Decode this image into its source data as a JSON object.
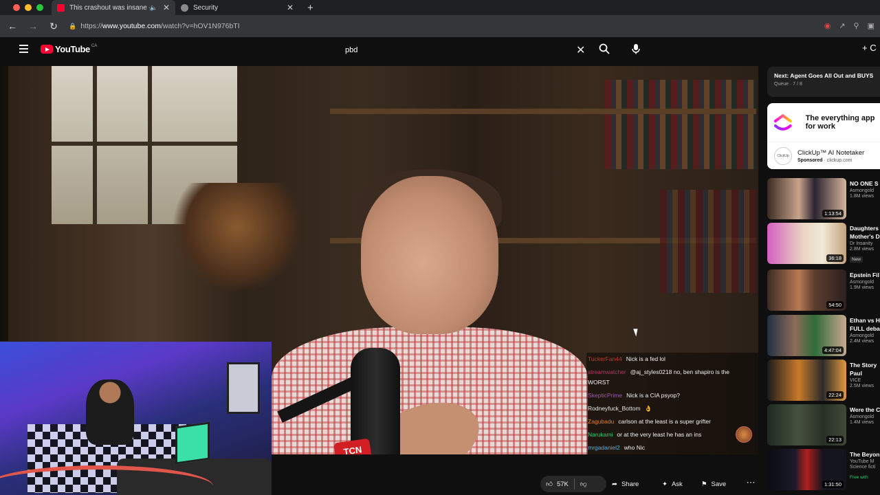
{
  "browser": {
    "tabs": [
      {
        "title": "This crashout was insane -",
        "favicon_color": "#ff0033",
        "active": true
      },
      {
        "title": "Security",
        "favicon_color": "#8a8a8a",
        "active": false
      }
    ],
    "url_scheme": "https://",
    "url_host": "www.youtube.com",
    "url_path": "/watch?v=hOV1N976bTI"
  },
  "youtube": {
    "logo_text": "YouTube",
    "country_code": "CA",
    "search_query": "pbd",
    "create_icon": "plus-icon"
  },
  "chat": [
    {
      "user": "TuckerFan44",
      "msg": "Nick is a fed lol",
      "color": "#c0392b"
    },
    {
      "user": "streamwatcher",
      "msg": "@aj_styles0218 no, ben shapiro is the",
      "color": "#b03a6b"
    },
    {
      "user": "",
      "msg": "WORST",
      "color": "#ffffff"
    },
    {
      "user": "SkepticPrime",
      "msg": "Nick is a CIA psyop?",
      "color": "#9b59b6"
    },
    {
      "user": "Rodneyfuck_Bottom",
      "msg": "",
      "color": "#e8e8e8"
    },
    {
      "user": "Zagubadu",
      "msg": "carlson at the least is a super grifter",
      "color": "#e67e22"
    },
    {
      "user": "Narukami",
      "msg": "or at the very least he has an ins",
      "color": "#2ecc71"
    },
    {
      "user": "mrgadaniel2",
      "msg": "who Nic",
      "color": "#5dade2"
    }
  ],
  "actions": {
    "likes": "57K",
    "share": "Share",
    "ask": "Ask",
    "save": "Save"
  },
  "sidebar": {
    "next": {
      "title": "Next: Agent Goes All Out and BUYS",
      "queue": "Queue · 7 / 8"
    },
    "ad": {
      "headline": "The everything app for work",
      "name": "ClickUp™ AI Notetaker",
      "sponsored": "Sponsored",
      "domain": "clickup.com",
      "avatar_text": "ClickUp"
    },
    "recs": [
      {
        "title": "NO ONE S",
        "channel": "Asmongold",
        "views": "1.8M views",
        "duration": "1:13:54",
        "badge": "",
        "thumb": "linear-gradient(90deg,#3b2b22,#c9a48c 40%,#2a2430 60%,#d4b59c)"
      },
      {
        "title": "Daughters",
        "title2": "Mother's D",
        "channel": "Dr Insanity",
        "views": "2.8M views",
        "duration": "36:18",
        "badge": "New",
        "thumb": "linear-gradient(90deg,#d35fbf,#e9d5c2 45%,#f1e8d8 70%,#c3a27a)"
      },
      {
        "title": "Epstein Fil",
        "channel": "Asmongold",
        "views": "1.9M views",
        "duration": "54:50",
        "badge": "",
        "thumb": "linear-gradient(90deg,#3a2a23,#b77a55 40%,#5b3d2d 60%,#2d2020)"
      },
      {
        "title": "Ethan vs H",
        "title2": "FULL deba",
        "channel": "Asmongold",
        "views": "2.4M views",
        "duration": "4:47:04",
        "badge": "",
        "thumb": "linear-gradient(90deg,#1f3140,#8d6c5a 35%,#2e6b3a 60%,#c7a98e)"
      },
      {
        "title": "The Story",
        "title2": "Paul",
        "channel": "VICE",
        "views": "2.5M views",
        "duration": "22:24",
        "badge": "",
        "thumb": "linear-gradient(90deg,#1b1b1b,#c97a2a 40%,#2b2b2b 70%,#e39a3c)"
      },
      {
        "title": "Were the C",
        "channel": "Asmongold",
        "views": "1.4M views",
        "duration": "22:13",
        "badge": "",
        "thumb": "linear-gradient(90deg,#1f2a20,#44523f 40%,#2a2f25 70%,#3f4a38)"
      },
      {
        "title": "The Beyon",
        "channel": "YouTube M",
        "views": "Science ficti",
        "duration": "1:31:50",
        "badge": "Free with",
        "thumb": "linear-gradient(90deg,#0b0b12,#1a1a2a 35%,#b0201e 50%,#15151f 70%)"
      }
    ]
  }
}
